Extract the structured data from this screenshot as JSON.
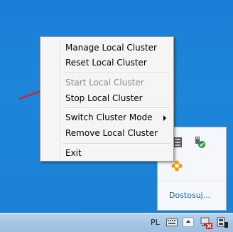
{
  "context_menu": {
    "items": [
      {
        "label": "Manage Local Cluster",
        "enabled": true
      },
      {
        "label": "Reset Local Cluster",
        "enabled": true
      },
      {
        "label": "Start Local Cluster",
        "enabled": false
      },
      {
        "label": "Stop Local Cluster",
        "enabled": true
      },
      {
        "label": "Switch Cluster Mode",
        "enabled": true,
        "has_submenu": true
      },
      {
        "label": "Remove Local Cluster",
        "enabled": true
      },
      {
        "label": "Exit",
        "enabled": true
      }
    ]
  },
  "tray_panel": {
    "customize_link": "Dostosuj..."
  },
  "taskbar": {
    "language": "PL"
  },
  "annotation": {
    "arrow_color": "#e02020"
  },
  "icons": [
    "keyboard-icon",
    "usb-check-icon",
    "flower-icon",
    "tray-expand-icon",
    "network-disconnected-icon",
    "volume-icon"
  ]
}
